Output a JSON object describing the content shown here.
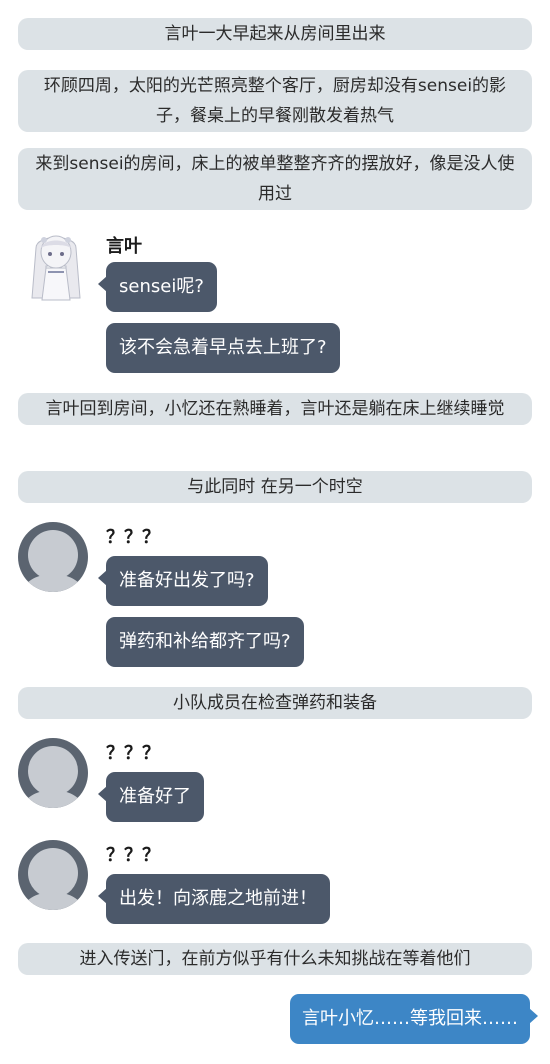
{
  "chat": {
    "narration_1": "言叶一大早起来从房间里出来",
    "narration_2": "环顾四周，太阳的光芒照亮整个客厅，厨房却没有sensei的影子，餐桌上的早餐刚散发着热气",
    "narration_3": "来到sensei的房间，床上的被单整整齐齐的摆放好，像是没人使用过",
    "group_kotoha": {
      "name": "言叶",
      "messages": [
        "sensei呢?",
        "该不会急着早点去上班了?"
      ]
    },
    "narration_4": "言叶回到房间，小忆还在熟睡着，言叶还是躺在床上继续睡觉",
    "narration_5": "与此同时 在另一个时空",
    "group_unknown_1": {
      "name": "？？？",
      "messages": [
        "准备好出发了吗?",
        "弹药和补给都齐了吗?"
      ]
    },
    "narration_6": "小队成员在检查弹药和装备",
    "group_unknown_2": {
      "name": "？？？",
      "messages": [
        "准备好了"
      ]
    },
    "group_unknown_3": {
      "name": "？？？",
      "messages": [
        "出发！向涿鹿之地前进！"
      ]
    },
    "narration_7": "进入传送门，在前方似乎有什么未知挑战在等着他们",
    "sent_message": "言叶小忆……等我回来……"
  },
  "colors": {
    "narration_bg": "#dce2e6",
    "incoming_bubble": "#4c586a",
    "outgoing_bubble": "#3d86c6",
    "avatar_placeholder": "#5b6470"
  },
  "icons": {
    "character_avatar": "kotoha-avatar-icon",
    "unknown_avatar": "default-user-avatar-icon"
  }
}
